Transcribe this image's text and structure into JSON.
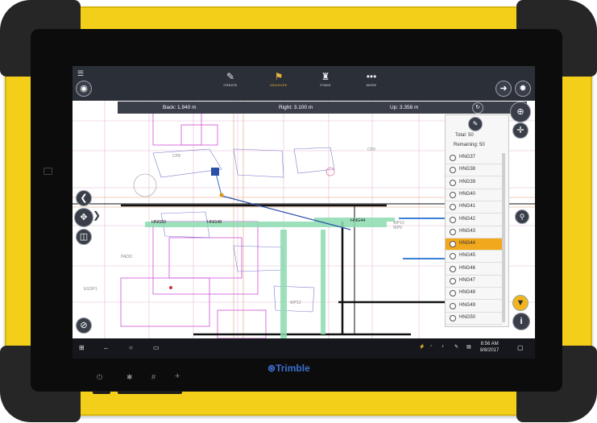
{
  "toolbar": {
    "create": "CREATE",
    "measure": "MEASURE",
    "stakeout": "STAKE",
    "more": "MORE"
  },
  "measure_bar": {
    "back": "Back: 1.940 m",
    "right": "Right: 3.100 m",
    "up": "Up: 3.358 m"
  },
  "panel": {
    "total": "Total: 50",
    "remaining": "Remaining: 50",
    "points": [
      "HNG37",
      "HNG38",
      "HNG39",
      "HNG40",
      "HNG41",
      "HNG42",
      "HNG43",
      "HNG44",
      "HNG45",
      "HNG46",
      "HNG47",
      "HNG48",
      "HNG49",
      "HNG50"
    ],
    "selected": "HNG44"
  },
  "map_labels": {
    "hng50": "HNG50",
    "hng48": "HNG48",
    "hng44": "HNG44",
    "wp10": "WP10",
    "wp9": "WP9",
    "cp9": "CP9",
    "wp12": "WP12",
    "cp8": "CP8",
    "padi": "PADI2",
    "egsp": "EGSP1"
  },
  "taskbar": {
    "time": "8:56 AM",
    "date": "8/8/2017"
  },
  "brand": "Trimble",
  "colors": {
    "tablet": "#f4cf1a",
    "bumper": "#262626",
    "app_bar": "#2b2f38",
    "selected_row": "#f2a81d",
    "brand_blue": "#3a6fd0"
  }
}
